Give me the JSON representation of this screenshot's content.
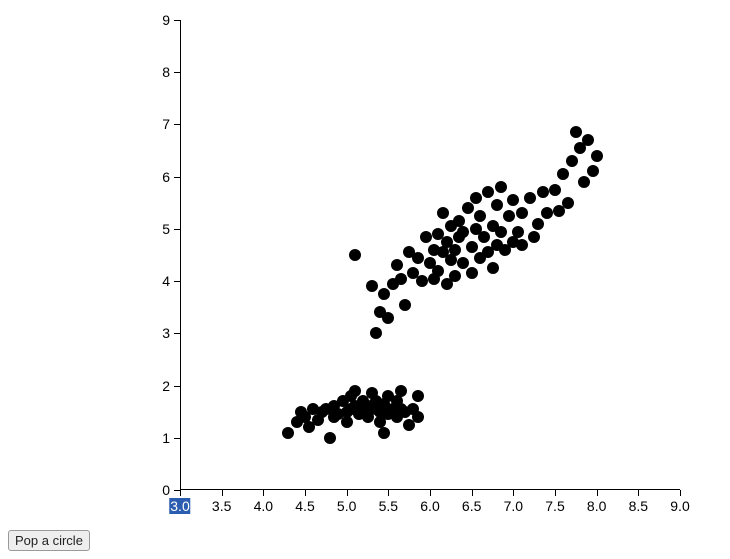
{
  "button": {
    "label": "Pop a circle"
  },
  "chart_data": {
    "type": "scatter",
    "xlabel": "",
    "ylabel": "",
    "title": "",
    "xlim": [
      3.0,
      9.0
    ],
    "ylim": [
      0,
      9
    ],
    "x_ticks": [
      3.0,
      3.5,
      4.0,
      4.5,
      5.0,
      5.5,
      6.0,
      6.5,
      7.0,
      7.5,
      8.0,
      8.5,
      9.0
    ],
    "y_ticks": [
      0,
      1,
      2,
      3,
      4,
      5,
      6,
      7,
      8,
      9
    ],
    "x_selected_tick": 3.0,
    "series": [
      {
        "name": "points",
        "points": [
          [
            4.3,
            1.1
          ],
          [
            4.4,
            1.3
          ],
          [
            4.45,
            1.5
          ],
          [
            4.5,
            1.4
          ],
          [
            4.55,
            1.2
          ],
          [
            4.6,
            1.55
          ],
          [
            4.65,
            1.35
          ],
          [
            4.7,
            1.5
          ],
          [
            4.75,
            1.55
          ],
          [
            4.8,
            1.0
          ],
          [
            4.85,
            1.4
          ],
          [
            4.85,
            1.6
          ],
          [
            4.9,
            1.45
          ],
          [
            4.95,
            1.7
          ],
          [
            5.0,
            1.3
          ],
          [
            5.0,
            1.5
          ],
          [
            5.05,
            1.55
          ],
          [
            5.05,
            1.8
          ],
          [
            5.1,
            1.6
          ],
          [
            5.1,
            1.9
          ],
          [
            5.15,
            1.45
          ],
          [
            5.2,
            1.55
          ],
          [
            5.2,
            1.7
          ],
          [
            5.25,
            1.4
          ],
          [
            5.25,
            1.6
          ],
          [
            5.3,
            1.85
          ],
          [
            5.35,
            1.55
          ],
          [
            5.35,
            1.7
          ],
          [
            5.4,
            1.3
          ],
          [
            5.4,
            1.5
          ],
          [
            5.45,
            1.1
          ],
          [
            5.45,
            1.65
          ],
          [
            5.5,
            1.45
          ],
          [
            5.5,
            1.8
          ],
          [
            5.55,
            1.55
          ],
          [
            5.6,
            1.4
          ],
          [
            5.6,
            1.7
          ],
          [
            5.65,
            1.55
          ],
          [
            5.65,
            1.9
          ],
          [
            5.7,
            1.5
          ],
          [
            5.75,
            1.25
          ],
          [
            5.8,
            1.55
          ],
          [
            5.85,
            1.4
          ],
          [
            5.85,
            1.8
          ],
          [
            5.1,
            4.5
          ],
          [
            5.3,
            3.9
          ],
          [
            5.35,
            3.0
          ],
          [
            5.4,
            3.4
          ],
          [
            5.45,
            3.75
          ],
          [
            5.5,
            3.3
          ],
          [
            5.55,
            3.95
          ],
          [
            5.6,
            4.3
          ],
          [
            5.65,
            4.05
          ],
          [
            5.7,
            3.55
          ],
          [
            5.75,
            4.55
          ],
          [
            5.8,
            4.15
          ],
          [
            5.85,
            4.45
          ],
          [
            5.9,
            4.0
          ],
          [
            5.95,
            4.85
          ],
          [
            6.0,
            4.35
          ],
          [
            6.05,
            4.05
          ],
          [
            6.05,
            4.6
          ],
          [
            6.1,
            4.2
          ],
          [
            6.1,
            4.9
          ],
          [
            6.15,
            4.55
          ],
          [
            6.15,
            5.3
          ],
          [
            6.2,
            3.95
          ],
          [
            6.2,
            4.75
          ],
          [
            6.25,
            4.4
          ],
          [
            6.25,
            5.05
          ],
          [
            6.3,
            4.1
          ],
          [
            6.3,
            4.6
          ],
          [
            6.35,
            4.85
          ],
          [
            6.35,
            5.15
          ],
          [
            6.4,
            4.35
          ],
          [
            6.4,
            4.95
          ],
          [
            6.45,
            5.4
          ],
          [
            6.5,
            4.15
          ],
          [
            6.5,
            4.65
          ],
          [
            6.55,
            5.0
          ],
          [
            6.55,
            5.6
          ],
          [
            6.6,
            4.45
          ],
          [
            6.6,
            5.25
          ],
          [
            6.65,
            4.85
          ],
          [
            6.7,
            4.55
          ],
          [
            6.7,
            5.7
          ],
          [
            6.75,
            4.25
          ],
          [
            6.75,
            5.05
          ],
          [
            6.8,
            4.7
          ],
          [
            6.8,
            5.45
          ],
          [
            6.85,
            4.95
          ],
          [
            6.85,
            5.8
          ],
          [
            6.9,
            4.6
          ],
          [
            6.95,
            5.25
          ],
          [
            7.0,
            4.75
          ],
          [
            7.0,
            5.55
          ],
          [
            7.05,
            4.95
          ],
          [
            7.1,
            4.7
          ],
          [
            7.1,
            5.3
          ],
          [
            7.2,
            5.6
          ],
          [
            7.25,
            4.85
          ],
          [
            7.3,
            5.1
          ],
          [
            7.35,
            5.7
          ],
          [
            7.4,
            5.3
          ],
          [
            7.5,
            5.75
          ],
          [
            7.55,
            5.35
          ],
          [
            7.6,
            6.05
          ],
          [
            7.65,
            5.5
          ],
          [
            7.7,
            6.3
          ],
          [
            7.75,
            6.85
          ],
          [
            7.8,
            6.55
          ],
          [
            7.85,
            5.9
          ],
          [
            7.9,
            6.7
          ],
          [
            7.95,
            6.1
          ],
          [
            8.0,
            6.4
          ]
        ]
      }
    ]
  }
}
